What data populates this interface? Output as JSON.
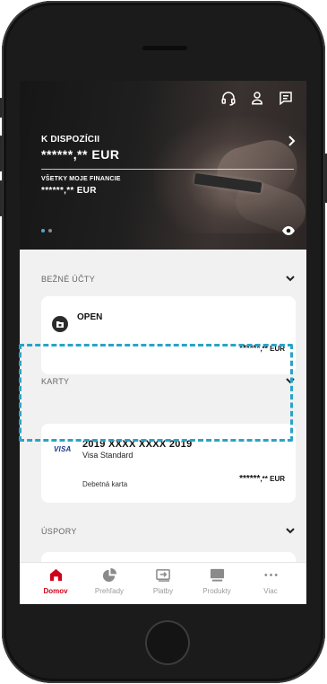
{
  "hero": {
    "available_label": "K DISPOZÍCII",
    "available_amount_masked": "******",
    "available_amount_tail": ",** EUR",
    "finance_label": "VŠETKY MOJE FINANCIE",
    "finance_amount_masked": "******",
    "finance_amount_tail": ",** EUR",
    "active_dot_color": "#4aa8d8"
  },
  "sections": {
    "current_accounts": {
      "title": "BEŽNÉ ÚČTY",
      "account_name": "OPEN",
      "amount_masked": "******",
      "amount_tail": ",** EUR"
    },
    "cards": {
      "title": "KARTY",
      "logo": "VISA",
      "card_number": "2019 XXXX XXXX 2019",
      "card_type": "Visa Standard",
      "card_kind": "Debetná karta",
      "amount_masked": "******",
      "amount_tail": ",** EUR"
    },
    "savings": {
      "title": "ÚSPORY"
    }
  },
  "tabs": [
    {
      "label": "Domov",
      "icon": "home-icon",
      "active": true
    },
    {
      "label": "Prehľady",
      "icon": "pie-chart-icon",
      "active": false
    },
    {
      "label": "Platby",
      "icon": "transfer-icon",
      "active": false
    },
    {
      "label": "Produkty",
      "icon": "card-icon",
      "active": false
    },
    {
      "label": "Viac",
      "icon": "more-icon",
      "active": false
    }
  ],
  "colors": {
    "accent": "#d0021b",
    "highlight": "#2aa3c7"
  }
}
